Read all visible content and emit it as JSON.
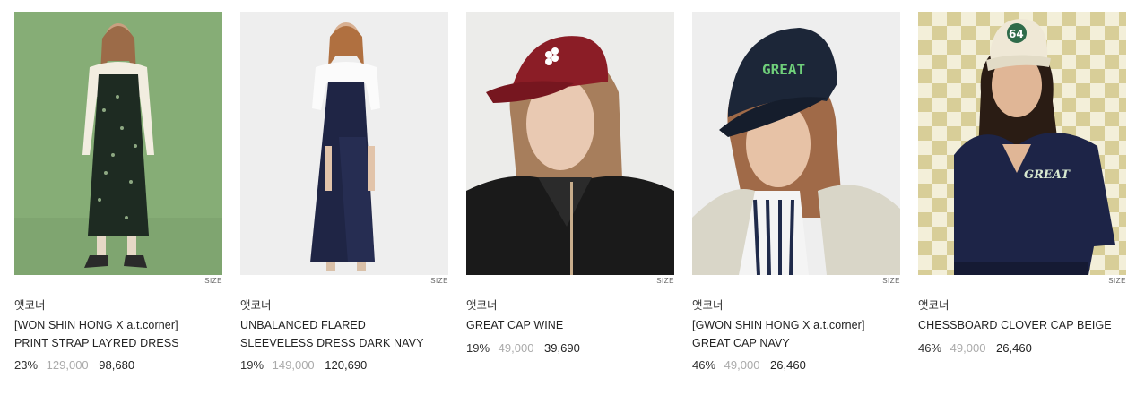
{
  "products": [
    {
      "brand": "앳코너",
      "name_line1": "[WON SHIN HONG X a.t.corner]",
      "name_line2": "PRINT STRAP LAYRED DRESS",
      "discount": "23%",
      "original_price": "129,000",
      "sale_price": "98,680",
      "size_label": "SIZE",
      "bg_color": "#86ad76"
    },
    {
      "brand": "앳코너",
      "name_line1": "UNBALANCED FLARED",
      "name_line2": "SLEEVELESS DRESS DARK NAVY",
      "discount": "19%",
      "original_price": "149,000",
      "sale_price": "120,690",
      "size_label": "SIZE",
      "bg_color": "#eeeeee"
    },
    {
      "brand": "앳코너",
      "name_line1": "GREAT CAP WINE",
      "name_line2": "",
      "discount": "19%",
      "original_price": "49,000",
      "sale_price": "39,690",
      "size_label": "SIZE",
      "bg_color": "#ececea"
    },
    {
      "brand": "앳코너",
      "name_line1": "[GWON SHIN HONG X a.t.corner]",
      "name_line2": "GREAT CAP NAVY",
      "discount": "46%",
      "original_price": "49,000",
      "sale_price": "26,460",
      "size_label": "SIZE",
      "bg_color": "#eeeeee"
    },
    {
      "brand": "앳코너",
      "name_line1": "CHESSBOARD CLOVER CAP BEIGE",
      "name_line2": "",
      "discount": "46%",
      "original_price": "49,000",
      "sale_price": "26,460",
      "size_label": "SIZE",
      "bg_color": "#e9e4c4"
    }
  ]
}
